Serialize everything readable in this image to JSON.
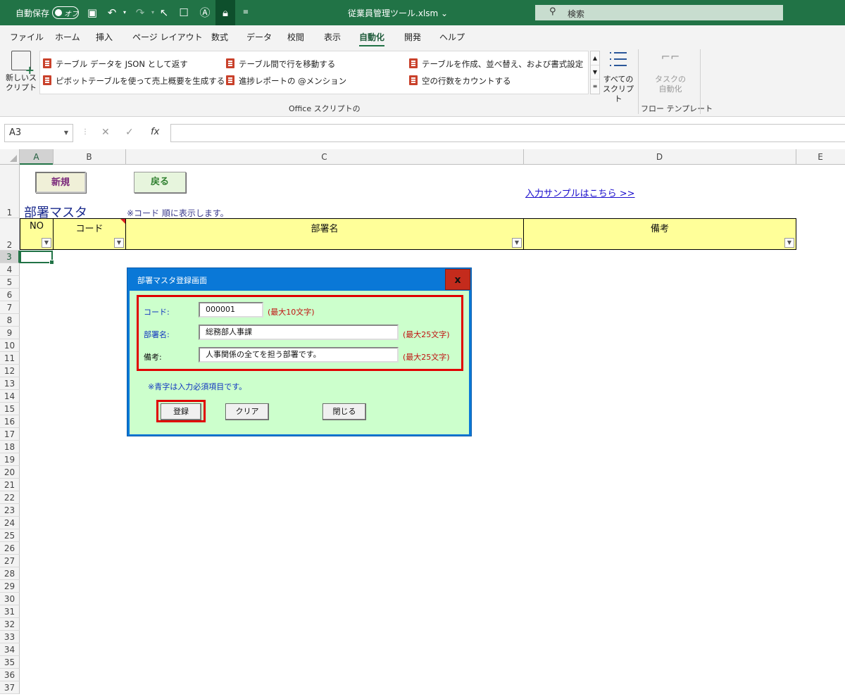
{
  "titlebar": {
    "autosave_label": "自動保存",
    "autosave_state": "オフ",
    "filename": "従業員管理ツール.xlsm",
    "filename_chevron": "⌄",
    "search_placeholder": "検索",
    "accent_color": "#217346"
  },
  "tabs": [
    "ファイル",
    "ホーム",
    "挿入",
    "ページ レイアウト",
    "数式",
    "データ",
    "校閲",
    "表示",
    "自動化",
    "開発",
    "ヘルプ"
  ],
  "active_tab": "自動化",
  "ribbon": {
    "new_script": "新しいス\nクリプト",
    "scripts": [
      "テーブル データを JSON として返す",
      "ピボットテーブルを使って売上概要を生成する",
      "テーブル間で行を移動する",
      "進捗レポートの @メンション",
      "テーブルを作成、並べ替え、および書式設定",
      "空の行数をカウントする"
    ],
    "all_scripts": "すべての\nスクリプト",
    "group_office": "Office スクリプトの",
    "task_automation": "タスクの\n自動化",
    "group_flow": "フロー テンプレート"
  },
  "formula_bar": {
    "name_box": "A3",
    "fx": "fx",
    "content": ""
  },
  "sheet": {
    "columns": [
      "A",
      "B",
      "C",
      "D",
      "E"
    ],
    "rows": [
      "1",
      "2",
      "3",
      "4",
      "5",
      "6",
      "7",
      "8",
      "9",
      "10",
      "11",
      "12",
      "13",
      "14",
      "15",
      "16",
      "17",
      "18",
      "19",
      "20",
      "21",
      "22",
      "23",
      "24",
      "25",
      "26",
      "27",
      "28",
      "29",
      "30",
      "31",
      "32",
      "33",
      "34",
      "35",
      "36",
      "37"
    ],
    "btn_new": "新規",
    "btn_back": "戻る",
    "sample_link": "入力サンプルはこちら >>",
    "title": "部署マスタ",
    "note": "※コード 順に表示します。",
    "headers": [
      "NO",
      "コード",
      "部署名",
      "備考"
    ]
  },
  "dialog": {
    "title": "部署マスタ登録画面",
    "close": "x",
    "code_label": "コード:",
    "code_value": "000001",
    "code_hint": "(最大10文字)",
    "dept_label": "部署名:",
    "dept_value": "総務部人事課",
    "dept_hint": "(最大25文字)",
    "memo_label": "備考:",
    "memo_value": "人事関係の全てを担う部署です。",
    "memo_hint": "(最大25文字)",
    "required_note": "※青字は入力必須項目です。",
    "btn_register": "登録",
    "btn_clear": "クリア",
    "btn_close": "閉じる"
  }
}
